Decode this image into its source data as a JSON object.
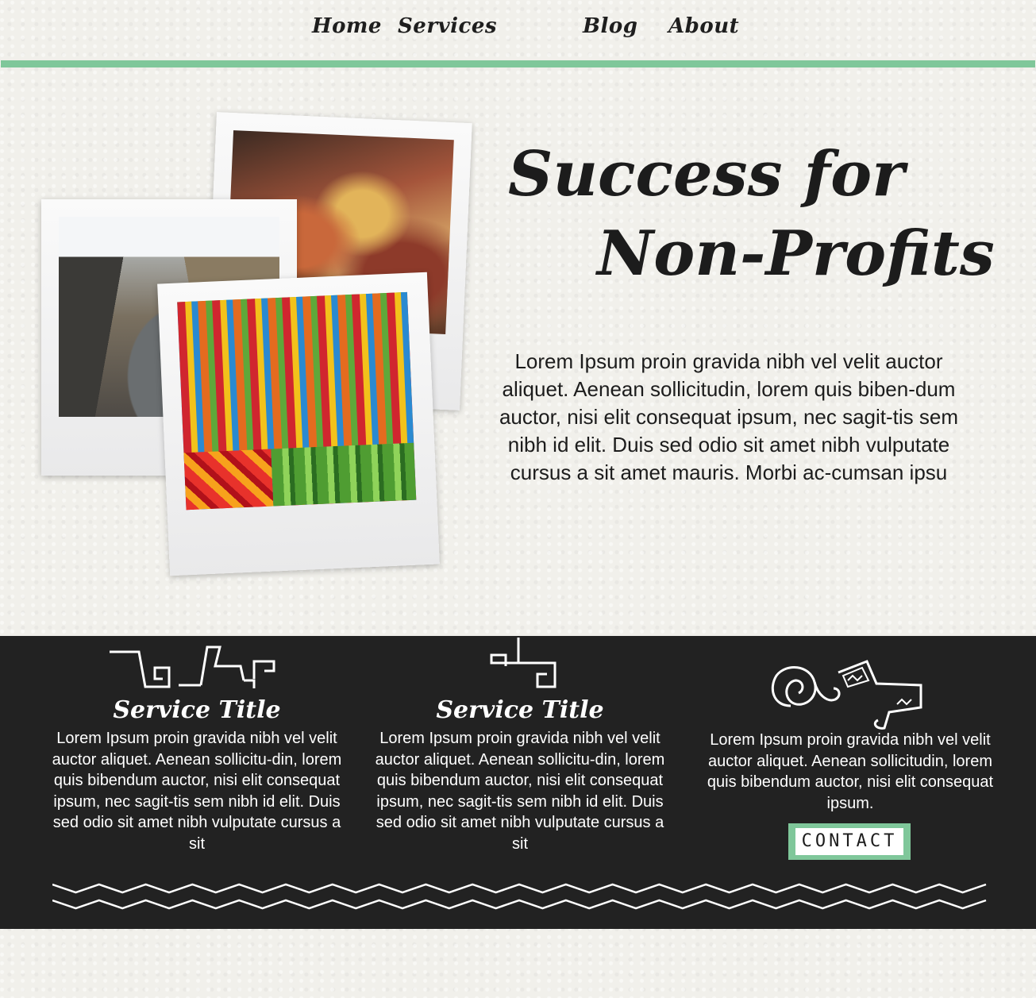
{
  "nav": {
    "items": [
      {
        "label": "Home"
      },
      {
        "label": "Services"
      },
      {
        "label": "Blog"
      },
      {
        "label": "About"
      }
    ]
  },
  "hero": {
    "title_line1": "Success for",
    "title_line2": "Non-Profits",
    "body": "Lorem Ipsum proin gravida nibh vel velit auctor aliquet. Aenean sollicitudin, lorem quis biben-dum auctor, nisi elit consequat ipsum, nec sagit-tis sem nibh id elit. Duis sed odio sit amet nibh vulputate cursus a sit amet mauris. Morbi ac-cumsan ipsu"
  },
  "services": [
    {
      "title": "Service Title",
      "body": "Lorem Ipsum proin gravida nibh vel velit auctor aliquet. Aenean sollicitu-din, lorem quis bibendum auctor, nisi elit consequat ipsum, nec sagit-tis sem nibh id elit. Duis sed odio sit amet nibh vulputate cursus a sit"
    },
    {
      "title": "Service Title",
      "body": "Lorem Ipsum proin gravida nibh vel velit auctor aliquet. Aenean sollicitu-din, lorem quis bibendum auctor, nisi elit consequat ipsum, nec sagit-tis sem nibh id elit. Duis sed odio sit amet nibh vulputate cursus a sit"
    },
    {
      "body": "Lorem Ipsum proin gravida nibh vel velit auctor aliquet. Aenean sollicitudin, lorem quis bibendum auctor, nisi elit consequat ipsum."
    }
  ],
  "contact": {
    "label": "CONTACT"
  },
  "colors": {
    "accent": "#7fc79a",
    "band": "#222222",
    "background": "#f1f0eb"
  }
}
